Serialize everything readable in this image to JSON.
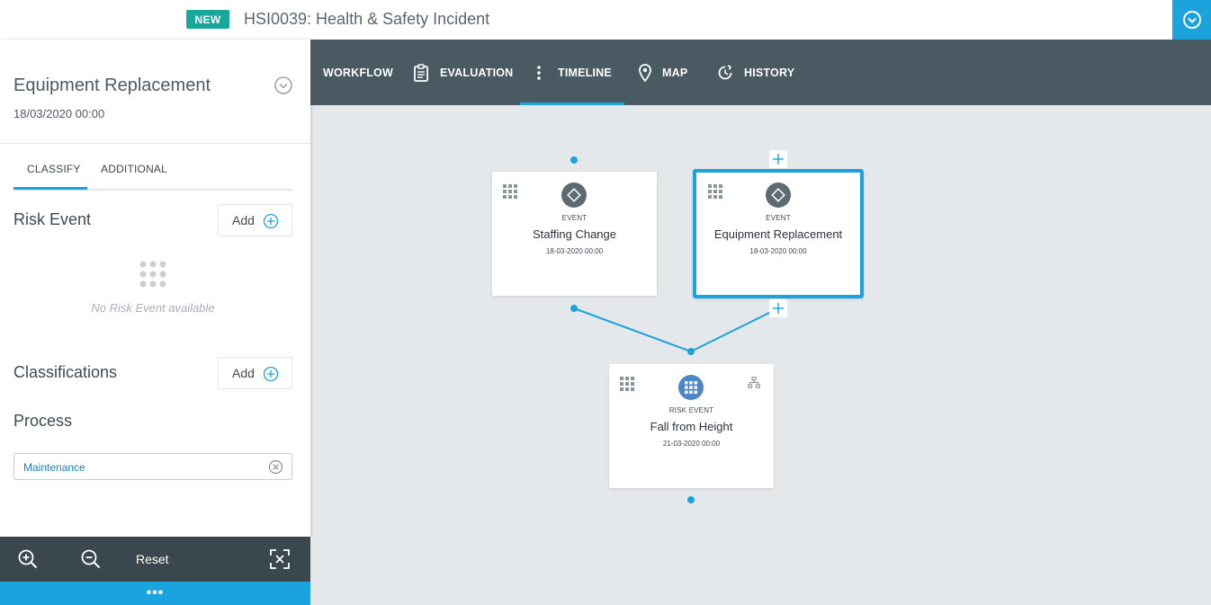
{
  "header": {
    "badge": "NEW",
    "title": "HSI0039: Health & Safety Incident",
    "toggle_icon": "chevron-down-circle-icon"
  },
  "panel": {
    "title": "Equipment Replacement",
    "date": "18/03/2020 00:00",
    "tabs": [
      {
        "label": "CLASSIFY",
        "active": true
      },
      {
        "label": "ADDITIONAL",
        "active": false
      }
    ],
    "risk_event": {
      "label": "Risk Event",
      "add_label": "Add",
      "empty_text": "No Risk Event available"
    },
    "classifications": {
      "label": "Classifications",
      "add_label": "Add"
    },
    "process": {
      "label": "Process",
      "value": "Maintenance"
    }
  },
  "zoombar": {
    "reset_label": "Reset",
    "more_label": "•••"
  },
  "nav": {
    "items": [
      {
        "label": "WORKFLOW",
        "icon": ""
      },
      {
        "label": "EVALUATION",
        "icon": "clipboard-icon"
      },
      {
        "label": "TIMELINE",
        "icon": "vertical-dots-icon",
        "active": true
      },
      {
        "label": "MAP",
        "icon": "map-pin-icon"
      },
      {
        "label": "HISTORY",
        "icon": "history-icon"
      }
    ]
  },
  "timeline": {
    "cards": [
      {
        "type": "EVENT",
        "title": "Staffing Change",
        "date": "18-03-2020 00:00",
        "selected": false
      },
      {
        "type": "EVENT",
        "title": "Equipment Replacement",
        "date": "18-03-2020 00:00",
        "selected": true
      },
      {
        "type": "RISK EVENT",
        "title": "Fall from Height",
        "date": "21-03-2020 00:00",
        "selected": false
      }
    ]
  },
  "colors": {
    "accent": "#1aa3dc",
    "badge": "#19a79b",
    "nav_bg": "#4a5a63",
    "zoombar_bg": "#3b474f",
    "canvas_bg": "#e5e8eb"
  }
}
